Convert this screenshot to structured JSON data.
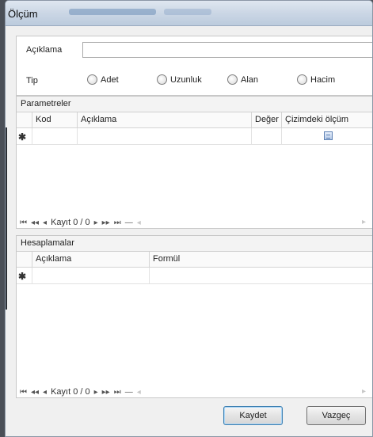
{
  "window": {
    "title": "Ölçüm"
  },
  "form": {
    "description_label": "Açıklama",
    "description_value": "",
    "type_label": "Tip",
    "type_options": [
      "Adet",
      "Uzunluk",
      "Alan",
      "Hacim"
    ]
  },
  "parameters": {
    "title": "Parametreler",
    "columns": [
      "Kod",
      "Açıklama",
      "Değer",
      "Çizimdeki ölçüm"
    ],
    "rows": [],
    "new_row_marker": "✱",
    "navigator": {
      "record_text": "Kayıt 0 / 0"
    }
  },
  "calculations": {
    "title": "Hesaplamalar",
    "columns": [
      "Açıklama",
      "Formül"
    ],
    "rows": [],
    "new_row_marker": "✱",
    "navigator": {
      "record_text": "Kayıt 0 / 0"
    }
  },
  "buttons": {
    "save": "Kaydet",
    "cancel": "Vazgeç"
  }
}
